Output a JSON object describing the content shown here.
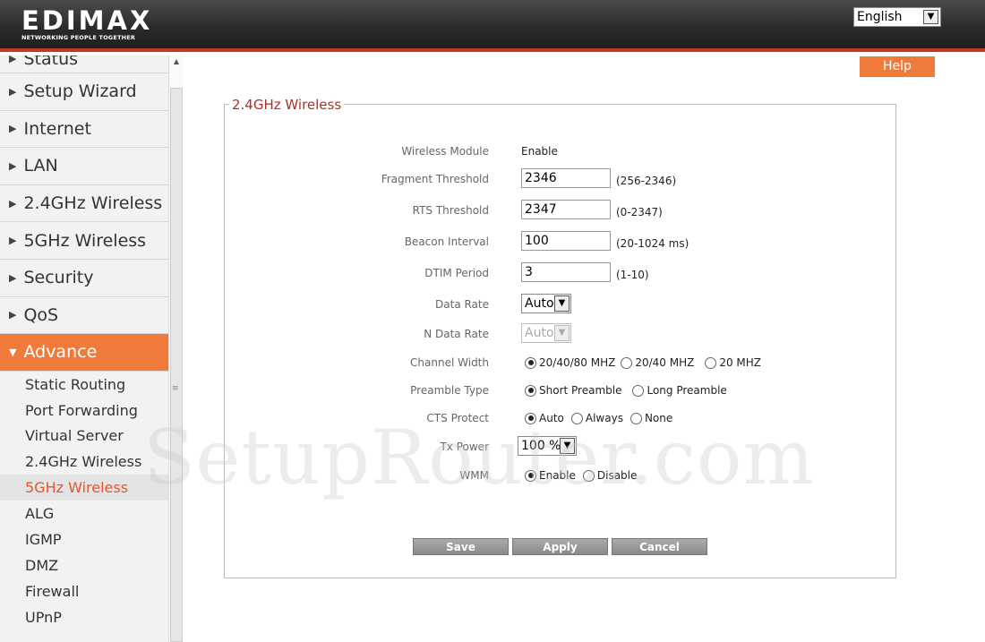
{
  "header": {
    "logo_text": "EDIMAX",
    "logo_tagline": "NETWORKING PEOPLE TOGETHER",
    "language": "English"
  },
  "sidebar": {
    "items": [
      {
        "label": "Status"
      },
      {
        "label": "Setup Wizard"
      },
      {
        "label": "Internet"
      },
      {
        "label": "LAN"
      },
      {
        "label": "2.4GHz Wireless"
      },
      {
        "label": "5GHz Wireless"
      },
      {
        "label": "Security"
      },
      {
        "label": "QoS"
      },
      {
        "label": "Advance"
      }
    ],
    "sub_items": [
      {
        "label": "Static Routing"
      },
      {
        "label": "Port Forwarding"
      },
      {
        "label": "Virtual Server"
      },
      {
        "label": "2.4GHz Wireless"
      },
      {
        "label": "5GHz Wireless"
      },
      {
        "label": "ALG"
      },
      {
        "label": "IGMP"
      },
      {
        "label": "DMZ"
      },
      {
        "label": "Firewall"
      },
      {
        "label": "UPnP"
      }
    ]
  },
  "help_label": "Help",
  "panel": {
    "title": "2.4GHz Wireless",
    "wireless_module": {
      "label": "Wireless Module",
      "value": "Enable"
    },
    "fragment_threshold": {
      "label": "Fragment Threshold",
      "value": "2346",
      "hint": "(256-2346)"
    },
    "rts_threshold": {
      "label": "RTS Threshold",
      "value": "2347",
      "hint": "(0-2347)"
    },
    "beacon_interval": {
      "label": "Beacon Interval",
      "value": "100",
      "hint": "(20-1024 ms)"
    },
    "dtim_period": {
      "label": "DTIM Period",
      "value": "3",
      "hint": "(1-10)"
    },
    "data_rate": {
      "label": "Data Rate",
      "value": "Auto"
    },
    "n_data_rate": {
      "label": "N Data Rate",
      "value": "Auto"
    },
    "channel_width": {
      "label": "Channel Width",
      "options": [
        "20/40/80 MHZ",
        "20/40 MHZ",
        "20 MHZ"
      ],
      "selected": 0
    },
    "preamble_type": {
      "label": "Preamble Type",
      "options": [
        "Short Preamble",
        "Long Preamble"
      ],
      "selected": 0
    },
    "cts_protect": {
      "label": "CTS Protect",
      "options": [
        "Auto",
        "Always",
        "None"
      ],
      "selected": 0
    },
    "tx_power": {
      "label": "Tx Power",
      "value": "100 %"
    },
    "wmm": {
      "label": "WMM",
      "options": [
        "Enable",
        "Disable"
      ],
      "selected": 0
    }
  },
  "buttons": {
    "save": "Save",
    "apply": "Apply",
    "cancel": "Cancel"
  },
  "watermark": "SetupRouter.com",
  "colors": {
    "accent": "#f07a3a",
    "title": "#a8322b",
    "header_line": "#c0392b"
  }
}
